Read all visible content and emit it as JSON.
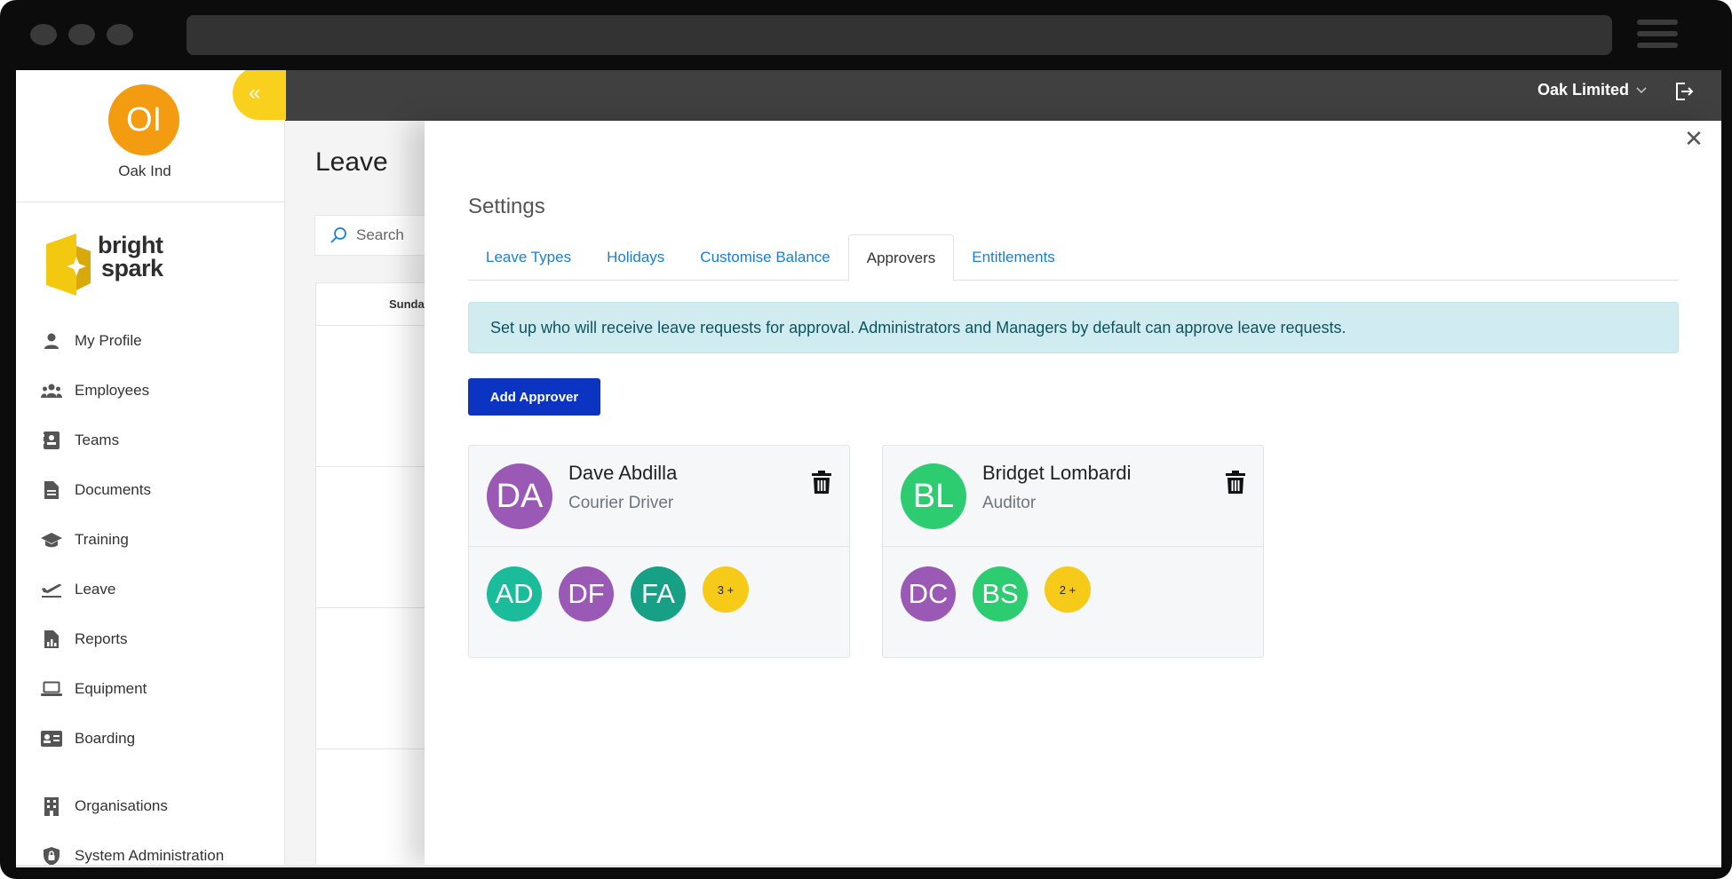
{
  "header": {
    "org_switch_label": "Oak Limited"
  },
  "sidebar": {
    "org_initials": "OI",
    "org_name": "Oak Ind",
    "logo_line1": "bright",
    "logo_line2": "spark",
    "items": [
      {
        "label": "My Profile",
        "icon": "user-icon"
      },
      {
        "label": "Employees",
        "icon": "users-icon"
      },
      {
        "label": "Teams",
        "icon": "id-card-icon"
      },
      {
        "label": "Documents",
        "icon": "document-icon"
      },
      {
        "label": "Training",
        "icon": "graduation-cap-icon"
      },
      {
        "label": "Leave",
        "icon": "plane-departure-icon"
      },
      {
        "label": "Reports",
        "icon": "report-icon"
      },
      {
        "label": "Equipment",
        "icon": "laptop-icon"
      },
      {
        "label": "Boarding",
        "icon": "badge-icon"
      }
    ],
    "admin_items": [
      {
        "label": "Organisations",
        "icon": "building-icon"
      },
      {
        "label": "System Administration",
        "icon": "shield-icon"
      }
    ]
  },
  "background_page": {
    "title": "Leave",
    "search_placeholder": "Search",
    "column_header": "Sunda"
  },
  "modal": {
    "title": "Settings",
    "tabs": [
      {
        "label": "Leave Types",
        "active": false
      },
      {
        "label": "Holidays",
        "active": false
      },
      {
        "label": "Customise Balance",
        "active": false
      },
      {
        "label": "Approvers",
        "active": true
      },
      {
        "label": "Entitlements",
        "active": false
      }
    ],
    "info_text": "Set up who will receive leave requests for approval. Administrators and Managers by default can approve leave requests.",
    "add_button_label": "Add Approver",
    "approvers": [
      {
        "initials": "DA",
        "name": "Dave Abdilla",
        "role": "Courier Driver",
        "color": "#9b59b6",
        "members": [
          {
            "initials": "AD",
            "color": "#1abc9c"
          },
          {
            "initials": "DF",
            "color": "#9b59b6"
          },
          {
            "initials": "FA",
            "color": "#16a085"
          }
        ],
        "more_label": "3 +"
      },
      {
        "initials": "BL",
        "name": "Bridget Lombardi",
        "role": "Auditor",
        "color": "#2ecc71",
        "members": [
          {
            "initials": "DC",
            "color": "#9b59b6"
          },
          {
            "initials": "BS",
            "color": "#2ecc71"
          }
        ],
        "more_label": "2 +"
      }
    ]
  },
  "colors": {
    "accent_yellow": "#f9d01e",
    "org_orange": "#f39c12",
    "primary_button": "#0b34c2",
    "tab_link": "#1a7fd4",
    "info_bg": "#d1ecf1",
    "info_text": "#0c5460"
  }
}
